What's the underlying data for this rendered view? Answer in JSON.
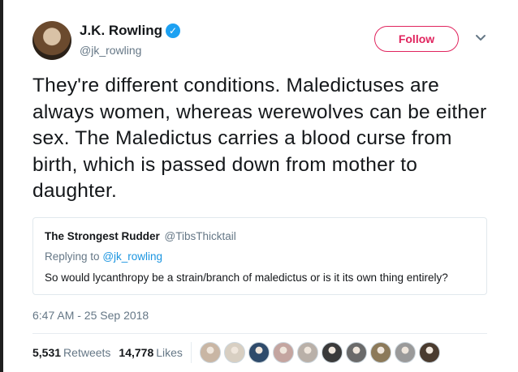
{
  "author": {
    "name": "J.K. Rowling",
    "handle": "@jk_rowling",
    "verified_icon": "verified-badge-icon"
  },
  "follow_label": "Follow",
  "tweet_text": "They're different conditions. Maledictuses are always women, whereas werewolves can be either sex. The Maledictus carries a blood curse from birth, which is passed down from mother to daughter.",
  "quote": {
    "name": "The Strongest Rudder",
    "handle": "@TibsThicktail",
    "replying_prefix": "Replying to",
    "replying_to": "@jk_rowling",
    "text": "So would lycanthropy be a strain/branch of maledictus or is it its own thing entirely?"
  },
  "timestamp": "6:47 AM - 25 Sep 2018",
  "stats": {
    "retweets_count": "5,531",
    "retweets_label": "Retweets",
    "likes_count": "14,778",
    "likes_label": "Likes"
  },
  "colors": {
    "follow_accent": "#e0245e",
    "link": "#1b95e0",
    "verified": "#1da1f2",
    "muted": "#657786"
  },
  "likers": [
    {
      "color": "#c9b6a4"
    },
    {
      "color": "#d8cfc2"
    },
    {
      "color": "#2f4b6b"
    },
    {
      "color": "#c4a5a0"
    },
    {
      "color": "#b9b0a8"
    },
    {
      "color": "#3a3a3a"
    },
    {
      "color": "#6a6a6a"
    },
    {
      "color": "#8c7a5a"
    },
    {
      "color": "#9a9a9a"
    },
    {
      "color": "#4a3b2f"
    }
  ]
}
